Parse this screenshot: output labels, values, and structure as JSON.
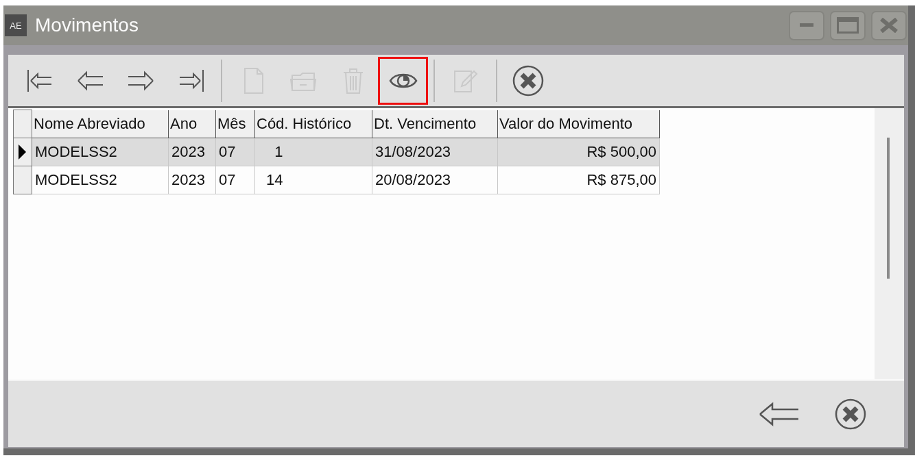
{
  "window": {
    "title": "Movimentos",
    "app_badge": "AE"
  },
  "toolbar": {
    "buttons": [
      {
        "kind": "first",
        "disabled": false,
        "highlighted": false
      },
      {
        "kind": "prev",
        "disabled": false,
        "highlighted": false
      },
      {
        "kind": "next",
        "disabled": false,
        "highlighted": false
      },
      {
        "kind": "last",
        "disabled": false,
        "highlighted": false
      },
      {
        "kind": "separator"
      },
      {
        "kind": "new",
        "disabled": true,
        "highlighted": false
      },
      {
        "kind": "open",
        "disabled": true,
        "highlighted": false
      },
      {
        "kind": "delete",
        "disabled": true,
        "highlighted": false
      },
      {
        "kind": "view",
        "disabled": false,
        "highlighted": true
      },
      {
        "kind": "separator"
      },
      {
        "kind": "edit",
        "disabled": true,
        "highlighted": false
      },
      {
        "kind": "separator"
      },
      {
        "kind": "cancel",
        "disabled": false,
        "highlighted": false
      }
    ]
  },
  "table": {
    "columns": [
      {
        "label": "Nome Abreviado",
        "kind": "text"
      },
      {
        "label": "Ano",
        "kind": "text"
      },
      {
        "label": "Mês",
        "kind": "text"
      },
      {
        "label": "Cód. Histórico",
        "kind": "code"
      },
      {
        "label": "Dt. Vencimento",
        "kind": "text"
      },
      {
        "label": "Valor do Movimento",
        "kind": "money"
      }
    ],
    "rows": [
      {
        "selected": true,
        "cells": [
          "MODELSS2",
          "2023",
          "07",
          "1",
          "31/08/2023",
          "R$ 500,00"
        ]
      },
      {
        "selected": false,
        "cells": [
          "MODELSS2",
          "2023",
          "07",
          "14",
          "20/08/2023",
          "R$ 875,00"
        ]
      }
    ]
  },
  "footer": {
    "buttons": [
      {
        "kind": "back"
      },
      {
        "kind": "cancel"
      }
    ]
  }
}
